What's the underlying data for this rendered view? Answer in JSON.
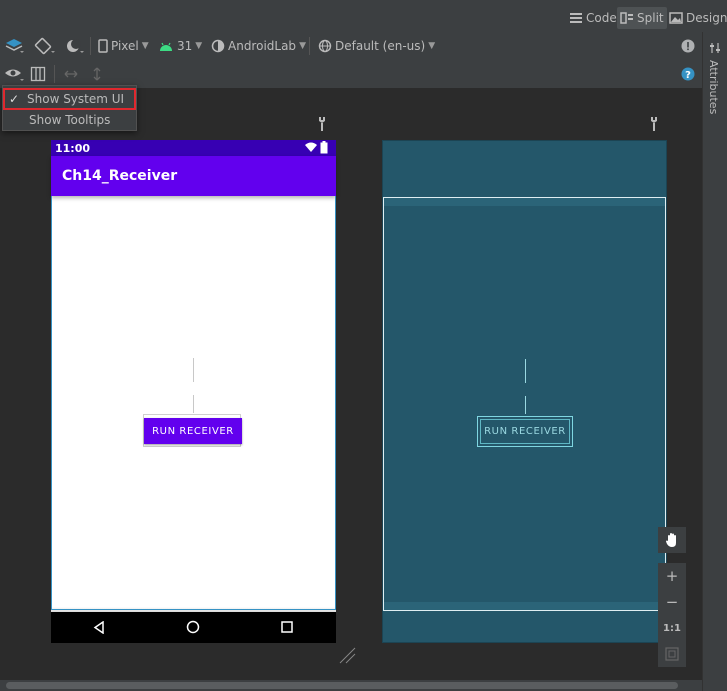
{
  "view_modes": {
    "code": "Code",
    "split": "Split",
    "design": "Design"
  },
  "toolbar": {
    "device": "Pixel",
    "api_level": "31",
    "theme": "AndroidLab",
    "locale": "Default (en-us)"
  },
  "dropdown": {
    "show_system_ui": "Show System UI",
    "show_system_ui_checked": true,
    "show_tooltips": "Show Tooltips"
  },
  "side_panel": {
    "attributes": "Attributes"
  },
  "phone": {
    "status_time": "11:00",
    "app_title": "Ch14_Receiver",
    "button_label": "RUN RECEIVER"
  },
  "blueprint": {
    "button_label": "RUN RECEIVER"
  },
  "zoom": {
    "plus": "+",
    "minus": "−",
    "actual_size": "1:1"
  },
  "colors": {
    "primary": "#6200ee",
    "primary_dark": "#3700b3",
    "blueprint_bg": "#24576a",
    "ide_bg": "#2b2b2b",
    "highlight": "#e0282e"
  }
}
